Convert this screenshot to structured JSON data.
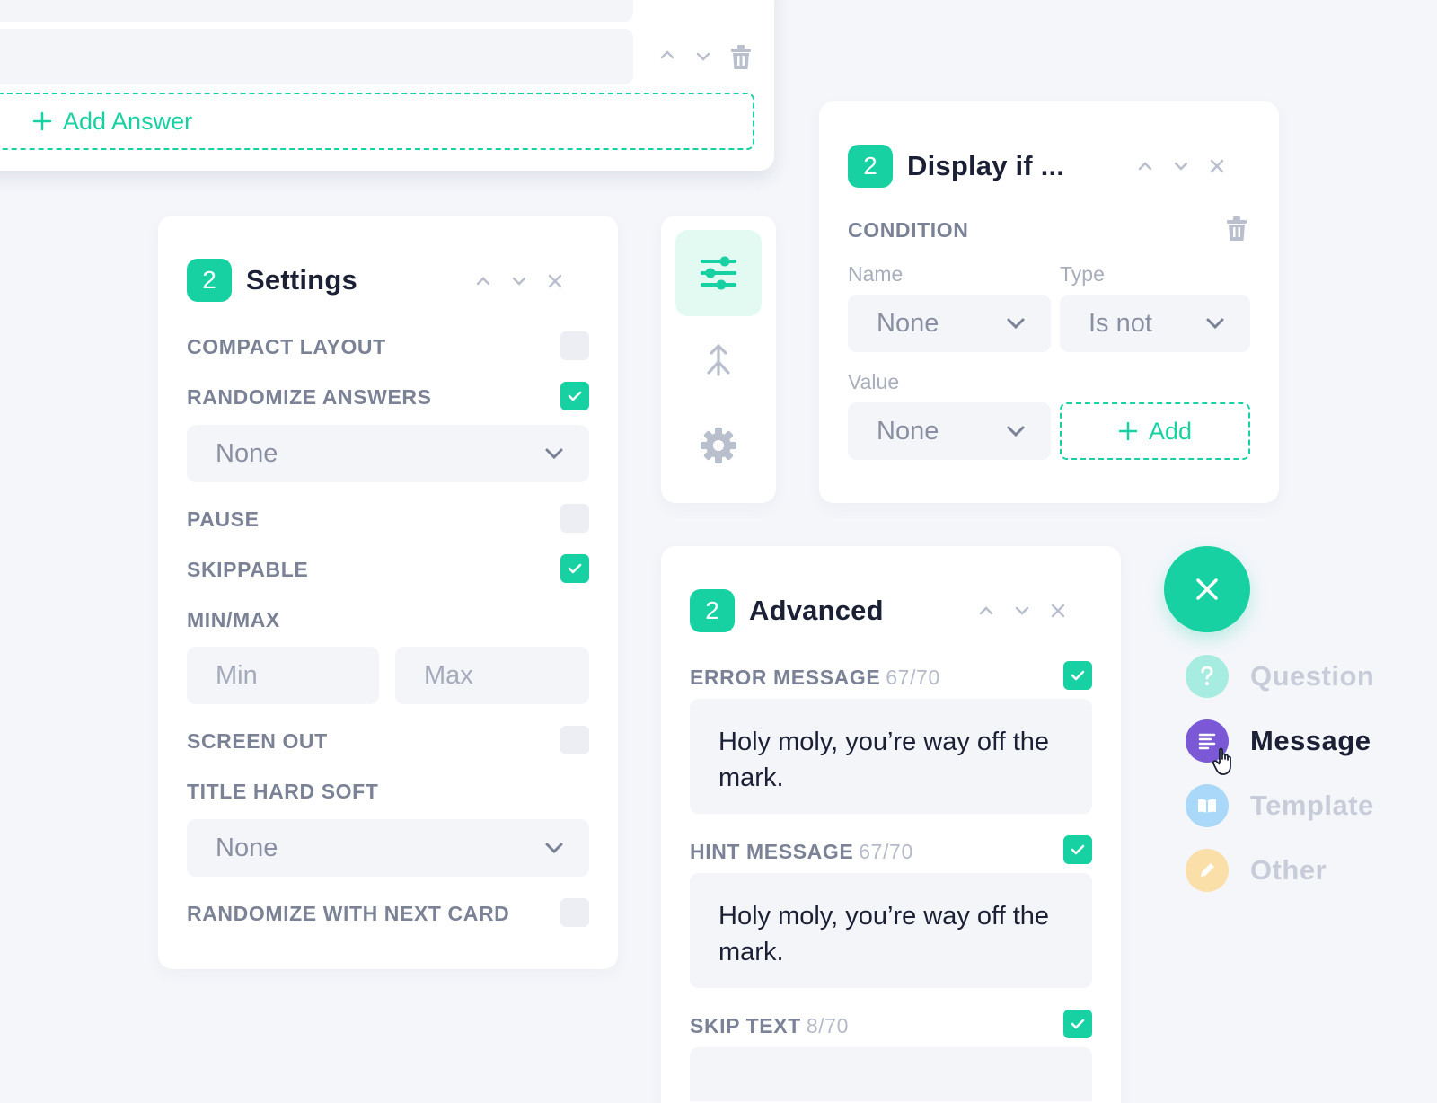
{
  "answers_card": {
    "add_answer_label": "Add Answer"
  },
  "settings": {
    "badge": "2",
    "title": "Settings",
    "compact_layout": "COMPACT LAYOUT",
    "randomize_answers": "RANDOMIZE ANSWERS",
    "randomize_select": "None",
    "pause": "PAUSE",
    "skippable": "SKIPPABLE",
    "minmax": "MIN/MAX",
    "min_placeholder": "Min",
    "max_placeholder": "Max",
    "screen_out": "SCREEN OUT",
    "title_hard_soft": "TITLE HARD SOFT",
    "title_select": "None",
    "randomize_next": "RANDOMIZE WITH NEXT CARD",
    "checks": {
      "compact_layout": false,
      "randomize_answers": true,
      "pause": false,
      "skippable": true,
      "screen_out": false,
      "randomize_next": false
    }
  },
  "toolbar": {
    "items": [
      "sliders-icon",
      "merge-icon",
      "gear-icon"
    ],
    "active": "sliders-icon"
  },
  "display_if": {
    "badge": "2",
    "title": "Display if ...",
    "condition": "CONDITION",
    "name_label": "Name",
    "type_label": "Type",
    "name_value": "None",
    "type_value": "Is not",
    "value_label": "Value",
    "value_value": "None",
    "add_label": "Add"
  },
  "advanced": {
    "badge": "2",
    "title": "Advanced",
    "error_label": "ERROR MESSAGE",
    "error_count": "67/70",
    "error_text": "Holy moly, you’re way off the mark.",
    "hint_label": "HINT MESSAGE",
    "hint_count": "67/70",
    "hint_text": "Holy moly, you’re way off the mark.",
    "skip_label": "SKIP TEXT",
    "skip_count": "8/70"
  },
  "fab_menu": {
    "items": [
      {
        "label": "Question",
        "icon": "question-icon",
        "color": "#18d1a3"
      },
      {
        "label": "Message",
        "icon": "message-icon",
        "color": "#7b58d6"
      },
      {
        "label": "Template",
        "icon": "book-icon",
        "color": "#4aa8ee"
      },
      {
        "label": "Other",
        "icon": "pencil-icon",
        "color": "#f5b23c"
      }
    ]
  },
  "colors": {
    "accent": "#18d1a3",
    "background": "#f4f6fa",
    "label": "#7b8296"
  }
}
